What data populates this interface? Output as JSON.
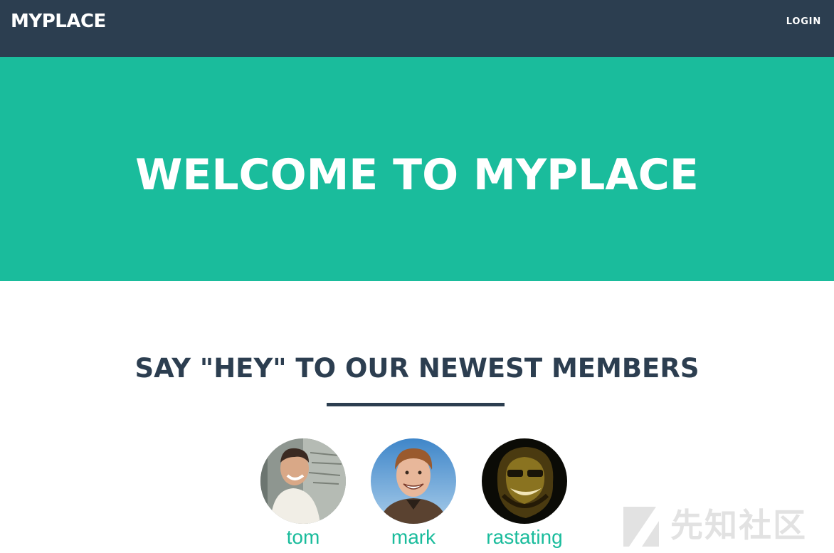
{
  "navbar": {
    "brand": "MYPLACE",
    "login_label": "LOGIN"
  },
  "hero": {
    "title": "WELCOME TO MYPLACE"
  },
  "members_section": {
    "title": "SAY \"HEY\" TO OUR NEWEST MEMBERS",
    "members": [
      {
        "name": "tom"
      },
      {
        "name": "mark"
      },
      {
        "name": "rastating"
      }
    ]
  },
  "watermark": {
    "text": "先知社区"
  },
  "colors": {
    "navbar": "#2c3e50",
    "accent": "#1abc9c",
    "heading": "#2c3e50"
  }
}
